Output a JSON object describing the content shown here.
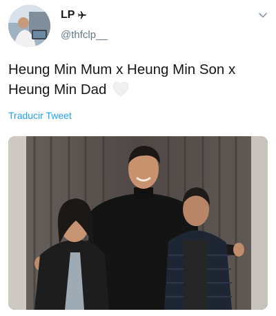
{
  "user": {
    "display_name": "LP",
    "badge_icon": "airplane-icon",
    "handle": "@thfclp__"
  },
  "tweet": {
    "text": "Heung Min Mum x Heung Min Son x Heung Min Dad",
    "emoji": "white-heart-emoji"
  },
  "actions": {
    "translate_label": "Traducir Tweet",
    "menu_icon": "chevron-down-icon"
  },
  "colors": {
    "link": "#1da1f2",
    "secondary_text": "#657786",
    "primary_text": "#14171a"
  }
}
